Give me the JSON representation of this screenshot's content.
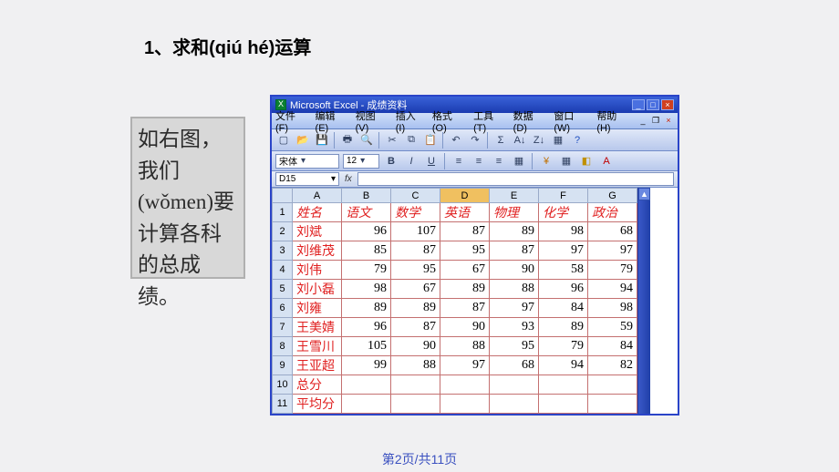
{
  "page": {
    "title": "1、求和(qiú hé)运算",
    "footer": "第2页/共11页"
  },
  "side_note": "如右图，我们(wǒmen)要计算各科的总成绩。",
  "excel": {
    "app_title": "Microsoft Excel - 成绩资料",
    "menus": [
      "文件(F)",
      "编辑(E)",
      "视图(V)",
      "插入(I)",
      "格式(O)",
      "工具(T)",
      "数据(D)",
      "窗口(W)",
      "帮助(H)"
    ],
    "font_name": "宋体",
    "font_size": "12",
    "cell_ref": "D15",
    "columns": [
      "A",
      "B",
      "C",
      "D",
      "E",
      "F",
      "G"
    ],
    "selected_col": "D",
    "headers": [
      "姓名",
      "语文",
      "数学",
      "英语",
      "物理",
      "化学",
      "政治"
    ],
    "rows": [
      {
        "r": 2,
        "name": "刘斌",
        "vals": [
          96,
          107,
          87,
          89,
          98,
          68
        ]
      },
      {
        "r": 3,
        "name": "刘维茂",
        "vals": [
          85,
          87,
          95,
          87,
          97,
          97
        ]
      },
      {
        "r": 4,
        "name": "刘伟",
        "vals": [
          79,
          95,
          67,
          90,
          58,
          79
        ]
      },
      {
        "r": 5,
        "name": "刘小磊",
        "vals": [
          98,
          67,
          89,
          88,
          96,
          94
        ]
      },
      {
        "r": 6,
        "name": "刘雍",
        "vals": [
          89,
          89,
          87,
          97,
          84,
          98
        ]
      },
      {
        "r": 7,
        "name": "王美婧",
        "vals": [
          96,
          87,
          90,
          93,
          89,
          59
        ]
      },
      {
        "r": 8,
        "name": "王雪川",
        "vals": [
          105,
          90,
          88,
          95,
          79,
          84
        ]
      },
      {
        "r": 9,
        "name": "王亚超",
        "vals": [
          99,
          88,
          97,
          68,
          94,
          82
        ]
      }
    ],
    "footer_rows": [
      {
        "r": 10,
        "label": "总分"
      },
      {
        "r": 11,
        "label": "平均分"
      }
    ]
  }
}
